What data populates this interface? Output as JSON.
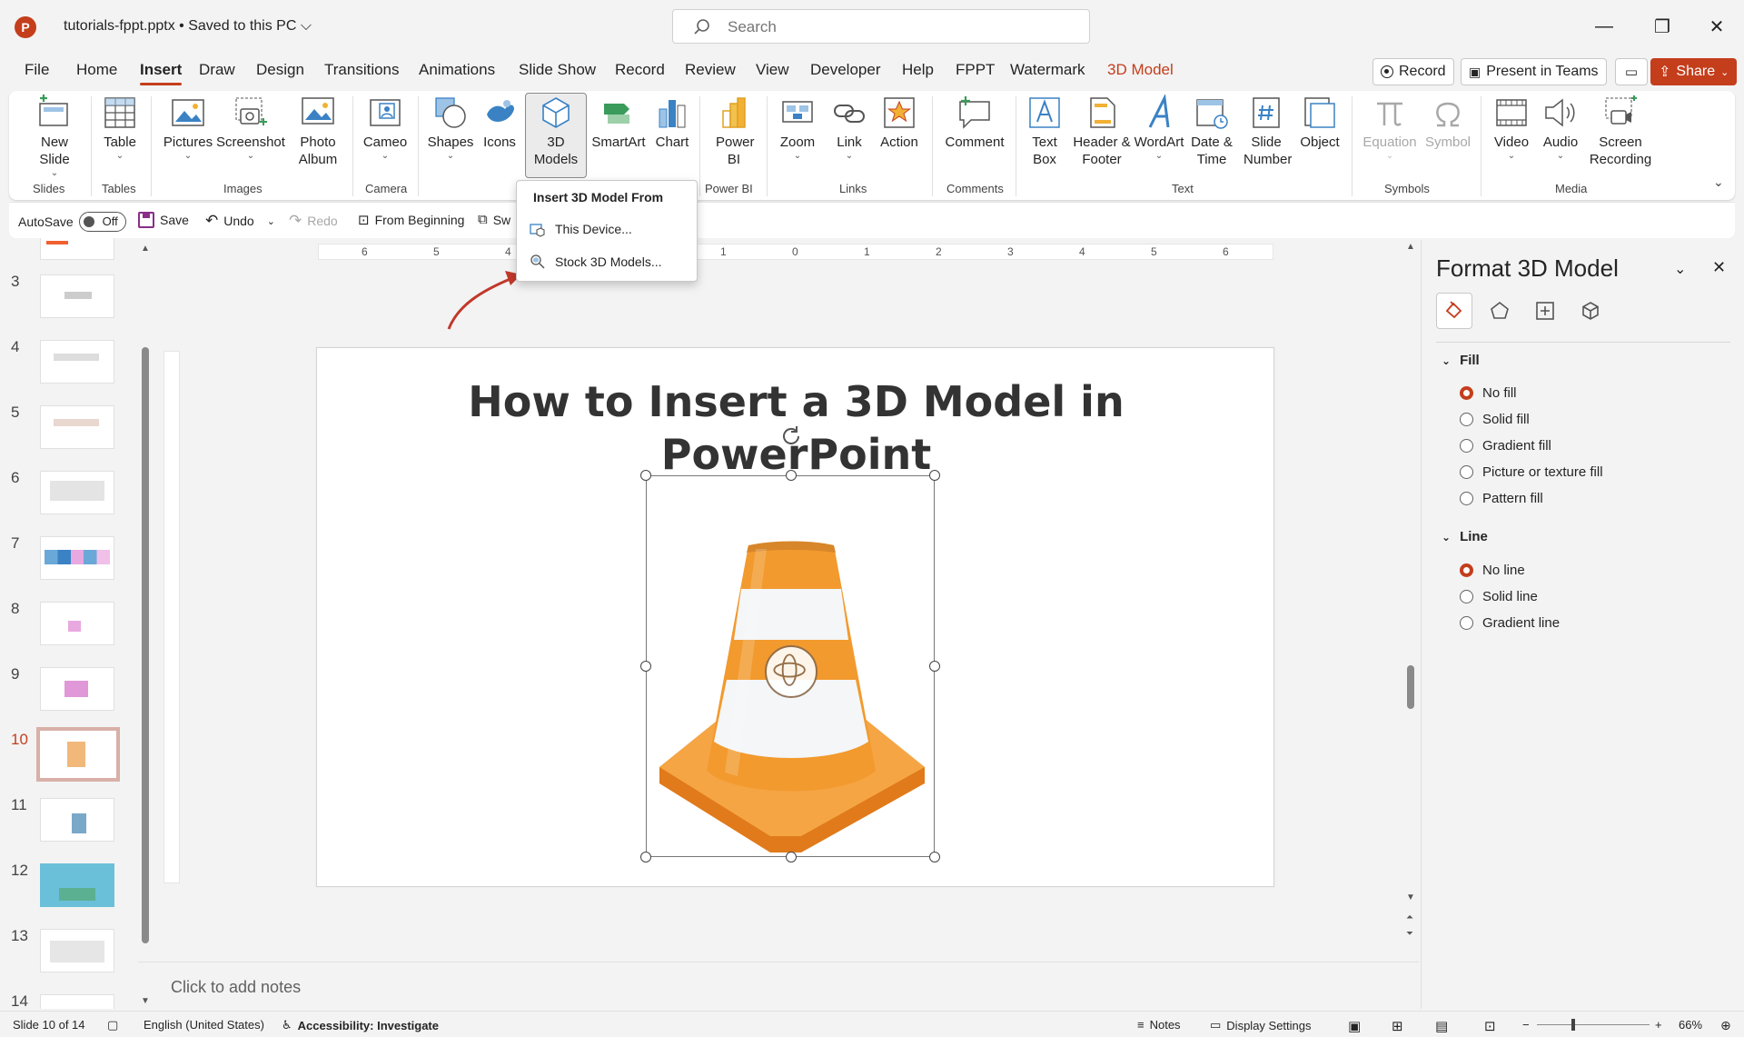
{
  "window": {
    "doc_title": "tutorials-fppt.pptx • Saved to this PC ⌵",
    "search_placeholder": "Search",
    "minimize": "—",
    "restore": "❐",
    "close": "✕"
  },
  "tabs": [
    "File",
    "Home",
    "Insert",
    "Draw",
    "Design",
    "Transitions",
    "Animations",
    "Slide Show",
    "Record",
    "Review",
    "View",
    "Developer",
    "Help",
    "FPPT",
    "Watermark",
    "3D Model"
  ],
  "active_tab": "Insert",
  "top_buttons": {
    "record": "Record",
    "present_teams": "Present in Teams",
    "share": "Share"
  },
  "ribbon": {
    "new_slide": "New Slide",
    "table": "Table",
    "pictures": "Pictures",
    "screenshot": "Screenshot",
    "photo_album": "Photo Album",
    "cameo": "Cameo",
    "shapes": "Shapes",
    "icons": "Icons",
    "models_3d": "3D Models",
    "smartart": "SmartArt",
    "chart": "Chart",
    "power_bi": "Power BI",
    "zoom": "Zoom",
    "link": "Link",
    "action": "Action",
    "comment": "Comment",
    "text_box": "Text Box",
    "header_footer": "Header & Footer",
    "wordart": "WordArt",
    "date_time": "Date & Time",
    "slide_number": "Slide Number",
    "object": "Object",
    "equation": "Equation",
    "symbol": "Symbol",
    "video": "Video",
    "audio": "Audio",
    "screen_recording": "Screen Recording",
    "groups": {
      "slides": "Slides",
      "tables": "Tables",
      "images": "Images",
      "camera": "Camera",
      "power_bi": "Power BI",
      "links": "Links",
      "comments": "Comments",
      "text": "Text",
      "symbols": "Symbols",
      "media": "Media"
    }
  },
  "qat": {
    "autosave": "AutoSave",
    "toggle": "Off",
    "save": "Save",
    "undo": "Undo",
    "redo": "Redo",
    "from_beginning": "From Beginning",
    "sw": "Sw"
  },
  "dropdown": {
    "title": "Insert 3D Model From",
    "this_device": "This Device...",
    "stock_models": "Stock 3D Models..."
  },
  "thumbnails": [
    "3",
    "4",
    "5",
    "6",
    "7",
    "8",
    "9",
    "10",
    "11",
    "12",
    "13",
    "14"
  ],
  "current_slide": "10",
  "ruler_labels": [
    "6",
    "5",
    "4",
    "3",
    "2",
    "1",
    "0",
    "1",
    "2",
    "3",
    "4",
    "5",
    "6"
  ],
  "slide": {
    "title_line1": "How to Insert a 3D Model in",
    "title_line2": "PowerPoint"
  },
  "notes_placeholder": "Click to add notes",
  "pane": {
    "title": "Format 3D Model",
    "fill_heading": "Fill",
    "fill_options": [
      "No fill",
      "Solid fill",
      "Gradient fill",
      "Picture or texture fill",
      "Pattern fill"
    ],
    "fill_selected": 0,
    "line_heading": "Line",
    "line_options": [
      "No line",
      "Solid line",
      "Gradient line"
    ],
    "line_selected": 0
  },
  "status": {
    "slide_of": "Slide 10 of 14",
    "language": "English (United States)",
    "accessibility": "Accessibility: Investigate",
    "notes": "Notes",
    "display_settings": "Display Settings",
    "zoom": "66%"
  },
  "colors": {
    "accent": "#c43e1c",
    "cone_orange": "#f29a2e",
    "cone_white": "#f4f6f8"
  }
}
